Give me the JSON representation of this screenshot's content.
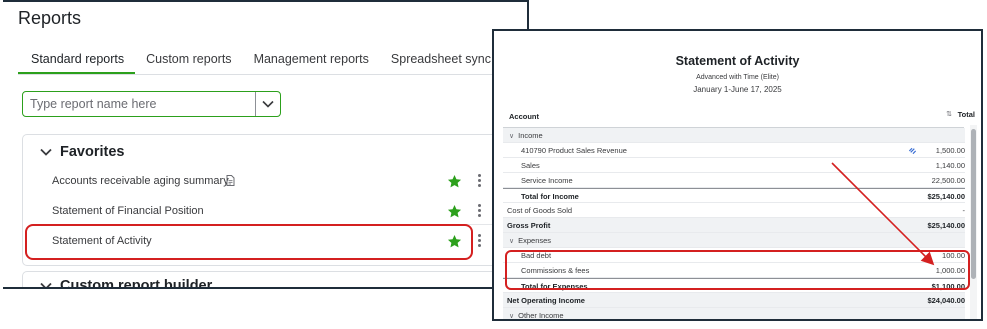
{
  "reports": {
    "title": "Reports",
    "tabs": [
      {
        "label": "Standard reports",
        "active": true
      },
      {
        "label": "Custom reports",
        "active": false
      },
      {
        "label": "Management reports",
        "active": false
      },
      {
        "label": "Spreadsheet sync",
        "active": false
      }
    ],
    "search": {
      "placeholder": "Type report name here",
      "value": ""
    },
    "favorites": {
      "title": "Favorites",
      "items": [
        {
          "label": "Accounts receivable aging summary",
          "icon": "document-icon",
          "starred": true
        },
        {
          "label": "Statement of Financial Position",
          "starred": true
        },
        {
          "label": "Statement of Activity",
          "starred": true
        }
      ]
    },
    "custom_builder": {
      "title": "Custom report builder"
    }
  },
  "statement": {
    "title": "Statement of Activity",
    "subtitle": "Advanced with Time (Elite)",
    "date_range": "January 1-June 17, 2025",
    "columns": {
      "account": "Account",
      "total": "Total"
    },
    "rows": [
      {
        "label": "Income",
        "amount": "",
        "type": "section"
      },
      {
        "label": "410790 Product Sales Revenue",
        "amount": "1,500.00",
        "type": "item"
      },
      {
        "label": "Sales",
        "amount": "1,140.00",
        "type": "item"
      },
      {
        "label": "Service Income",
        "amount": "22,500.00",
        "type": "item"
      },
      {
        "label": "Total for Income",
        "amount": "$25,140.00",
        "type": "subtotal"
      },
      {
        "label": "Cost of Goods Sold",
        "amount": "-",
        "type": "plain"
      },
      {
        "label": "Gross Profit",
        "amount": "$25,140.00",
        "type": "total"
      },
      {
        "label": "Expenses",
        "amount": "",
        "type": "section"
      },
      {
        "label": "Bad debt",
        "amount": "100.00",
        "type": "item"
      },
      {
        "label": "Commissions & fees",
        "amount": "1,000.00",
        "type": "item"
      },
      {
        "label": "Total for Expenses",
        "amount": "$1,100.00",
        "type": "subtotal"
      },
      {
        "label": "Net Operating Income",
        "amount": "$24,040.00",
        "type": "total"
      },
      {
        "label": "Other Income",
        "amount": "",
        "type": "section"
      }
    ]
  },
  "colors": {
    "brand_green": "#2ca01c",
    "highlight_red": "#d42020",
    "star_green": "#2ca01c"
  }
}
